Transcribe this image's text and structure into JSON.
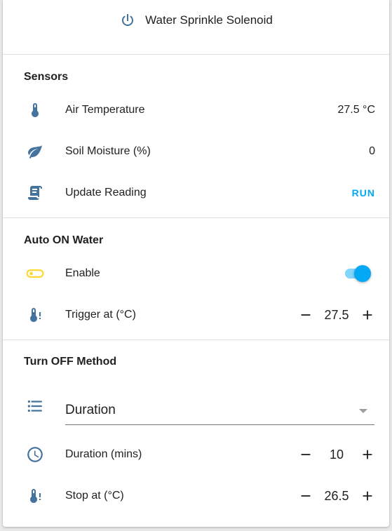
{
  "header": {
    "title": "Water Sprinkle Solenoid",
    "icon": "power-icon"
  },
  "sensors": {
    "title": "Sensors",
    "air_temp": {
      "label": "Air Temperature",
      "value": "27.5 °C",
      "icon": "thermometer-icon"
    },
    "soil": {
      "label": "Soil Moisture (%)",
      "value": "0",
      "icon": "leaf-icon"
    },
    "update": {
      "label": "Update Reading",
      "action": "RUN",
      "icon": "script-icon"
    }
  },
  "auto_on": {
    "title": "Auto ON Water",
    "enable": {
      "label": "Enable",
      "on": true,
      "icon": "toggle-icon"
    },
    "trigger": {
      "label": "Trigger at (°C)",
      "value": "27.5",
      "icon": "thermometer-alert-icon"
    }
  },
  "turn_off": {
    "title": "Turn OFF Method",
    "method": {
      "selected": "Duration",
      "icon": "list-icon"
    },
    "duration": {
      "label": "Duration (mins)",
      "value": "10",
      "icon": "clock-icon"
    },
    "stop_at": {
      "label": "Stop at (°C)",
      "value": "26.5",
      "icon": "thermometer-alert-icon"
    }
  },
  "colors": {
    "icon": "#44739e",
    "accent": "#03a9f4",
    "toggle_icon": "#fdd835"
  }
}
